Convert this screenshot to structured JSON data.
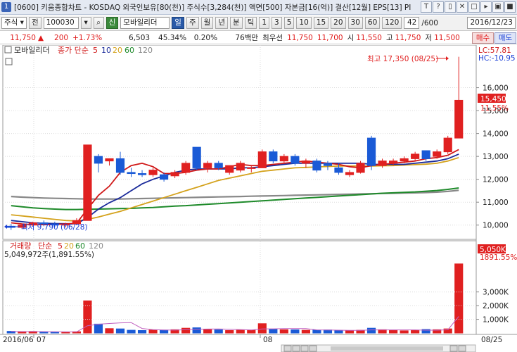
{
  "title": {
    "window_number": "1",
    "text": "[0600] 키움종합차트 - KOSDAQ 외국인보유[80(천)] 주식수[3,284(천)] 액면[500] 자본금[16(억)] 결산[12월] EPS[13] PI"
  },
  "titlebar_icons": [
    "T",
    "?",
    "▯",
    "✕",
    "□",
    "▸",
    "▣",
    "■"
  ],
  "toolbar": {
    "market": "주식",
    "market_arrow": "▾",
    "all_btn": "전",
    "code": "100030",
    "code_arrow": "▾",
    "search_icon": "⌕",
    "name_prefix": "신",
    "stock_name": "모바일리더",
    "periods": [
      "일",
      "주",
      "월",
      "년",
      "분",
      "틱"
    ],
    "active_period": "일",
    "nums": [
      "1",
      "3",
      "5",
      "10",
      "15",
      "20",
      "30",
      "60",
      "120"
    ],
    "count": "42",
    "total": "/600",
    "date": "2016/12/23"
  },
  "price": {
    "current": "11,750",
    "change_arrow": "▲",
    "change": "200",
    "pct": "+1.73%",
    "volume": "6,503",
    "vol_ratio": "45.34%",
    "turnover": "0.20%",
    "trade_value": "76백만",
    "best": "최우선",
    "ask": "11,750",
    "bid": "11,700",
    "open_label": "시",
    "open": "11,550",
    "high_label": "고",
    "high": "11,750",
    "low_label": "저",
    "low": "11,500",
    "buy_btn": "매수",
    "sell_btn": "매도"
  },
  "chart": {
    "price_legend": {
      "name": "모바일리더",
      "series": "종가 단순",
      "p5": "5",
      "p10": "10",
      "p20": "20",
      "p60": "60",
      "p120": "120"
    },
    "lc": "LC:57.81",
    "hc": "HC:-10.95",
    "y_ticks": [
      "16,000",
      "15,000",
      "14,000",
      "13,000",
      "12,000",
      "11,000",
      "10,000"
    ],
    "last_price": "15,450",
    "last_pct": "11.55%",
    "high_annotation": "최고 17,350 (08/25)",
    "low_annotation": "최저 9,790 (06/28)",
    "vol_legend": {
      "name": "거래량",
      "series": "단순",
      "p5": "5",
      "p20": "20",
      "p60": "60",
      "p120": "120"
    },
    "vol_info": "5,049,972주(1,891.55%)",
    "vol_ticks": [
      "3,000K",
      "2,000K",
      "1,000K"
    ],
    "vol_last": "5,050K",
    "vol_last_pct": "1891.55%",
    "x_labels": [
      "2016/06",
      "07",
      "08"
    ],
    "x_right": "08/25",
    "colors": {
      "up": "#e02020",
      "down": "#1a5ad6",
      "ma5": "#d01818",
      "ma10": "#1a2a9a",
      "ma20": "#d4a21c",
      "ma60": "#1e8a2a",
      "ma120": "#888888"
    }
  },
  "chart_data": {
    "type": "candlestick",
    "title": "",
    "ylim": [
      9500,
      17800
    ],
    "candles": [
      {
        "o": 9950,
        "h": 10050,
        "l": 9790,
        "c": 9900
      },
      {
        "o": 9900,
        "h": 10050,
        "l": 9850,
        "c": 10000
      },
      {
        "o": 10000,
        "h": 10150,
        "l": 9950,
        "c": 10100
      },
      {
        "o": 10100,
        "h": 10200,
        "l": 9950,
        "c": 10050
      },
      {
        "o": 10050,
        "h": 10150,
        "l": 9900,
        "c": 10000
      },
      {
        "o": 10000,
        "h": 10100,
        "l": 9900,
        "c": 10050
      },
      {
        "o": 10050,
        "h": 10300,
        "l": 10000,
        "c": 10200
      },
      {
        "o": 10200,
        "h": 13500,
        "l": 10200,
        "c": 13500
      },
      {
        "o": 13000,
        "h": 13100,
        "l": 12300,
        "c": 12700
      },
      {
        "o": 12800,
        "h": 12900,
        "l": 12600,
        "c": 12900
      },
      {
        "o": 12900,
        "h": 13200,
        "l": 12200,
        "c": 12300
      },
      {
        "o": 12300,
        "h": 12500,
        "l": 12100,
        "c": 12250
      },
      {
        "o": 12250,
        "h": 12400,
        "l": 12100,
        "c": 12200
      },
      {
        "o": 12200,
        "h": 12500,
        "l": 12100,
        "c": 12400
      },
      {
        "o": 12200,
        "h": 12300,
        "l": 11900,
        "c": 12000
      },
      {
        "o": 12150,
        "h": 12400,
        "l": 12050,
        "c": 12300
      },
      {
        "o": 12300,
        "h": 12800,
        "l": 12200,
        "c": 12700
      },
      {
        "o": 13400,
        "h": 13400,
        "l": 12400,
        "c": 12500
      },
      {
        "o": 12500,
        "h": 12800,
        "l": 12300,
        "c": 12700
      },
      {
        "o": 12700,
        "h": 12800,
        "l": 12400,
        "c": 12500
      },
      {
        "o": 12300,
        "h": 12600,
        "l": 12200,
        "c": 12600
      },
      {
        "o": 12400,
        "h": 12800,
        "l": 12300,
        "c": 12700
      },
      {
        "o": 12500,
        "h": 12600,
        "l": 12300,
        "c": 12500
      },
      {
        "o": 12500,
        "h": 13300,
        "l": 12500,
        "c": 13200
      },
      {
        "o": 13200,
        "h": 13300,
        "l": 12700,
        "c": 12800
      },
      {
        "o": 12800,
        "h": 13100,
        "l": 12700,
        "c": 13000
      },
      {
        "o": 13000,
        "h": 13100,
        "l": 12600,
        "c": 12700
      },
      {
        "o": 12700,
        "h": 12900,
        "l": 12500,
        "c": 12800
      },
      {
        "o": 12800,
        "h": 12900,
        "l": 12300,
        "c": 12400
      },
      {
        "o": 12700,
        "h": 12800,
        "l": 12400,
        "c": 12600
      },
      {
        "o": 12500,
        "h": 12700,
        "l": 12200,
        "c": 12300
      },
      {
        "o": 12200,
        "h": 12400,
        "l": 12100,
        "c": 12300
      },
      {
        "o": 12300,
        "h": 12800,
        "l": 12250,
        "c": 12700
      },
      {
        "o": 13800,
        "h": 13900,
        "l": 12400,
        "c": 12600
      },
      {
        "o": 12600,
        "h": 12900,
        "l": 12500,
        "c": 12800
      },
      {
        "o": 12700,
        "h": 12900,
        "l": 12600,
        "c": 12800
      },
      {
        "o": 12800,
        "h": 13000,
        "l": 12700,
        "c": 12900
      },
      {
        "o": 12900,
        "h": 13200,
        "l": 12800,
        "c": 13100
      },
      {
        "o": 13250,
        "h": 13250,
        "l": 12800,
        "c": 12900
      },
      {
        "o": 13000,
        "h": 13300,
        "l": 12900,
        "c": 13200
      },
      {
        "o": 13200,
        "h": 13900,
        "l": 13100,
        "c": 13800
      },
      {
        "o": 13800,
        "h": 17350,
        "l": 13800,
        "c": 15450
      }
    ],
    "volume": [
      120,
      90,
      110,
      80,
      70,
      60,
      90,
      2350,
      650,
      320,
      300,
      200,
      180,
      220,
      210,
      240,
      350,
      380,
      260,
      230,
      180,
      200,
      210,
      680,
      260,
      240,
      230,
      200,
      210,
      220,
      180,
      170,
      200,
      350,
      240,
      180,
      160,
      200,
      260,
      240,
      300,
      5050
    ],
    "ma5": [
      10100,
      10050,
      10020,
      10020,
      10030,
      10050,
      10080,
      10700,
      11300,
      11700,
      12300,
      12600,
      12700,
      12550,
      12250,
      12250,
      12300,
      12400,
      12450,
      12450,
      12550,
      12650,
      12600,
      12600,
      12650,
      12700,
      12750,
      12800,
      12750,
      12700,
      12650,
      12550,
      12500,
      12600,
      12650,
      12700,
      12750,
      12800,
      12900,
      12950,
      13050,
      13300
    ],
    "ma10": [
      10200,
      10150,
      10100,
      10080,
      10070,
      10060,
      10060,
      10330,
      10700,
      10980,
      11200,
      11500,
      11800,
      12000,
      12150,
      12300,
      12400,
      12450,
      12450,
      12450,
      12450,
      12500,
      12500,
      12550,
      12600,
      12650,
      12700,
      12700,
      12700,
      12700,
      12700,
      12700,
      12700,
      12650,
      12650,
      12650,
      12650,
      12700,
      12750,
      12800,
      12900,
      13100
    ],
    "ma20": [
      10450,
      10400,
      10350,
      10300,
      10250,
      10200,
      10180,
      10250,
      10350,
      10480,
      10600,
      10750,
      10900,
      11050,
      11200,
      11350,
      11500,
      11650,
      11800,
      11950,
      12050,
      12150,
      12250,
      12350,
      12400,
      12450,
      12500,
      12520,
      12540,
      12560,
      12580,
      12580,
      12580,
      12580,
      12590,
      12600,
      12620,
      12640,
      12660,
      12700,
      12800,
      12950
    ],
    "ma60": [
      10850,
      10800,
      10750,
      10720,
      10700,
      10680,
      10680,
      10690,
      10700,
      10710,
      10720,
      10730,
      10750,
      10770,
      10800,
      10830,
      10850,
      10880,
      10910,
      10940,
      10970,
      11000,
      11030,
      11060,
      11090,
      11120,
      11150,
      11180,
      11210,
      11240,
      11270,
      11300,
      11330,
      11360,
      11390,
      11410,
      11430,
      11450,
      11480,
      11510,
      11560,
      11620
    ],
    "ma120": [
      11250,
      11220,
      11200,
      11180,
      11170,
      11160,
      11150,
      11140,
      11140,
      11140,
      11140,
      11150,
      11160,
      11170,
      11180,
      11190,
      11200,
      11210,
      11220,
      11230,
      11240,
      11250,
      11260,
      11270,
      11280,
      11290,
      11300,
      11310,
      11320,
      11330,
      11340,
      11350,
      11360,
      11370,
      11380,
      11390,
      11400,
      11410,
      11420,
      11440,
      11470,
      11520
    ],
    "vol_ylim": [
      0,
      5300
    ]
  }
}
